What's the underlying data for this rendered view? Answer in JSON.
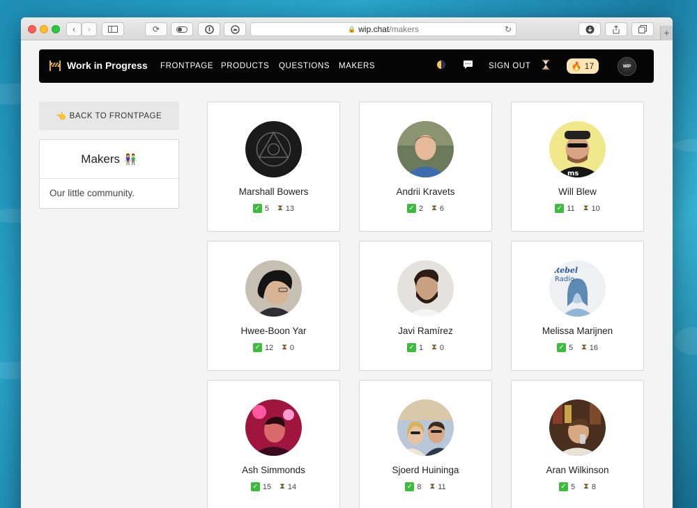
{
  "browser": {
    "url_host": "wip.chat",
    "url_path": "/makers"
  },
  "nav": {
    "brand": "Work in Progress",
    "links": [
      "FRONTPAGE",
      "PRODUCTS",
      "QUESTIONS",
      "MAKERS"
    ],
    "sign_out": "SIGN OUT",
    "streak_count": "17",
    "avatar_text": "WIP",
    "icons": [
      "moon-icon",
      "chat-bubble-icon",
      "hourglass-icon",
      "fire-icon"
    ]
  },
  "sidebar": {
    "back_label": "BACK TO FRONTPAGE",
    "title": "Makers",
    "description": "Our little community."
  },
  "makers": [
    {
      "name": "Marshall Bowers",
      "done": "5",
      "pending": "13"
    },
    {
      "name": "Andrii Kravets",
      "done": "2",
      "pending": "6"
    },
    {
      "name": "Will Blew",
      "done": "11",
      "pending": "10"
    },
    {
      "name": "Hwee-Boon Yar",
      "done": "12",
      "pending": "0"
    },
    {
      "name": "Javi Ramírez",
      "done": "1",
      "pending": "0"
    },
    {
      "name": "Melissa Marijnen",
      "done": "5",
      "pending": "16"
    },
    {
      "name": "Ash Simmonds",
      "done": "15",
      "pending": "14"
    },
    {
      "name": "Sjoerd Huininga",
      "done": "8",
      "pending": "11"
    },
    {
      "name": "Aran Wilkinson",
      "done": "5",
      "pending": "8"
    }
  ],
  "colors": {
    "nav_bg": "#050505",
    "streak_bg": "#fbe6b3",
    "check_green": "#3dbb3c"
  }
}
